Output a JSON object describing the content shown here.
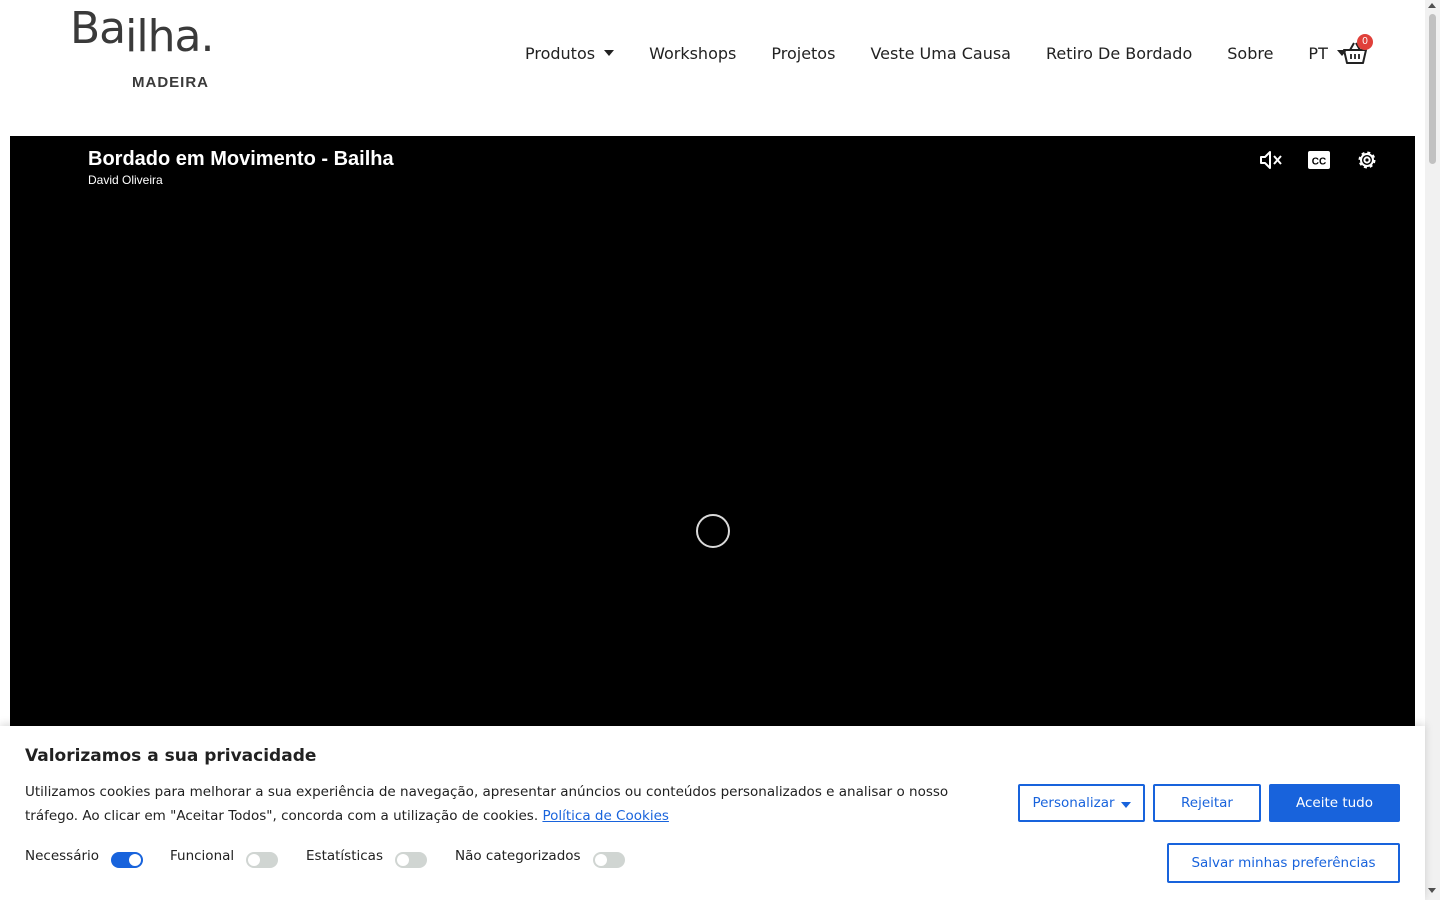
{
  "logo": {
    "main_ba": "Ba",
    "main_ilha": "ilha.",
    "sub": "MADEIRA"
  },
  "nav": {
    "items": [
      {
        "label": "Produtos",
        "has_dropdown": true
      },
      {
        "label": "Workshops",
        "has_dropdown": false
      },
      {
        "label": "Projetos",
        "has_dropdown": false
      },
      {
        "label": "Veste Uma Causa",
        "has_dropdown": false
      },
      {
        "label": "Retiro De Bordado",
        "has_dropdown": false
      },
      {
        "label": "Sobre",
        "has_dropdown": false
      },
      {
        "label": "PT",
        "has_dropdown": true
      }
    ],
    "cart_count": "0",
    "cart_icon": "basket-icon"
  },
  "video": {
    "title": "Bordado em Movimento - Bailha",
    "author": "David Oliveira",
    "icons": [
      "mute-icon",
      "closed-captions-icon",
      "settings-gear-icon"
    ],
    "state": "loading"
  },
  "cookie_banner": {
    "title": "Valorizamos a sua privacidade",
    "text": "Utilizamos cookies para melhorar a sua experiência de navegação, apresentar anúncios ou conteúdos personalizados e analisar o nosso tráfego. Ao clicar em \"Aceitar Todos\", concorda com a utilização de cookies.",
    "policy_link": "Política de Cookies",
    "categories": [
      {
        "label": "Necessário",
        "enabled": true
      },
      {
        "label": "Funcional",
        "enabled": false
      },
      {
        "label": "Estatísticas",
        "enabled": false
      },
      {
        "label": "Não categorizados",
        "enabled": false
      }
    ],
    "customize_label": "Personalizar",
    "reject_label": "Rejeitar",
    "accept_label": "Aceite tudo",
    "save_label": "Salvar minhas preferências"
  },
  "colors": {
    "accent": "#1863dc",
    "badge": "#e0403a",
    "video_bg": "#000000"
  }
}
